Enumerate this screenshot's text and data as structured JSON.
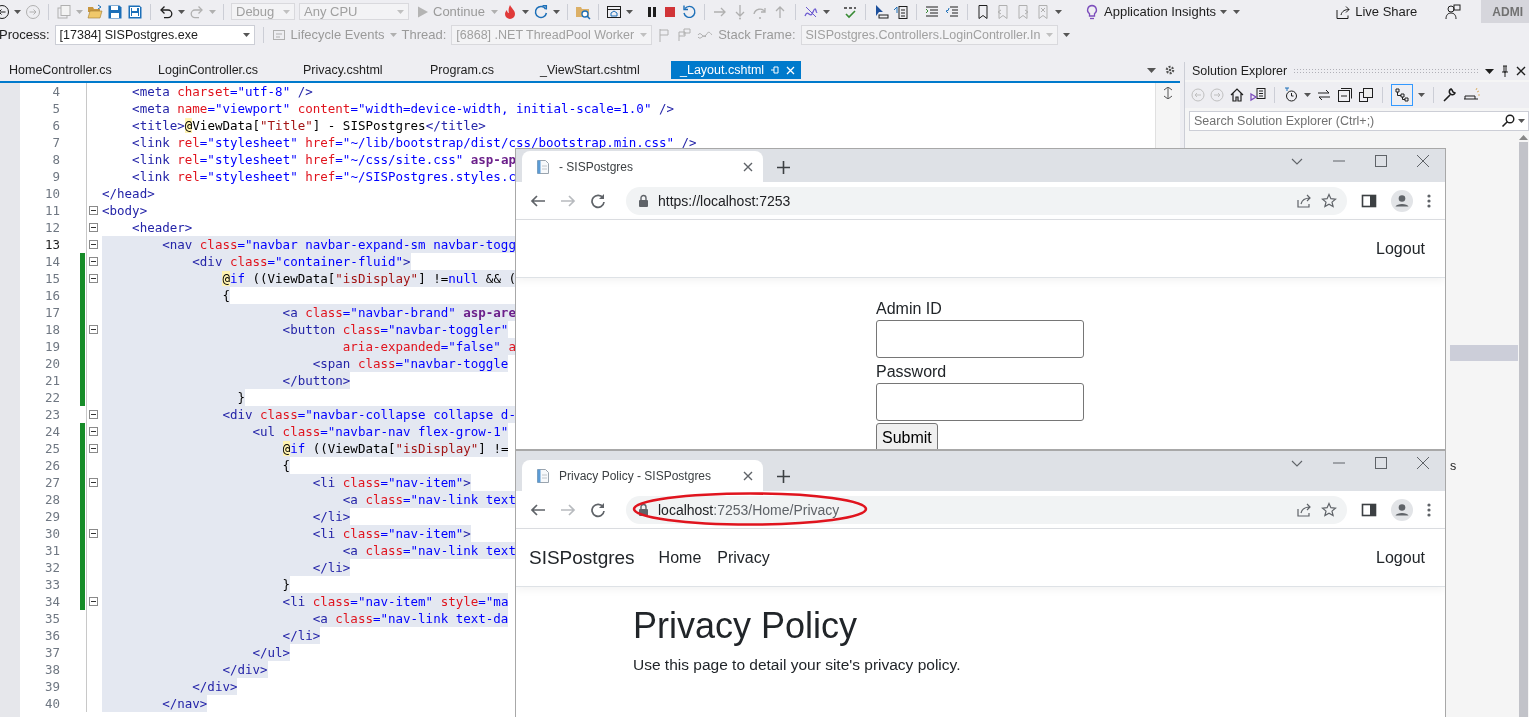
{
  "toolbar": {
    "configuration": "Debug",
    "platform": "Any CPU",
    "continue": "Continue",
    "insights": "Application Insights",
    "live_share": "Live Share",
    "account": "ADMI"
  },
  "debug_location": {
    "process_label": "Process:",
    "process": "[17384] SISPostgres.exe",
    "lifecycle": "Lifecycle Events",
    "thread_label": "Thread:",
    "thread": "[6868] .NET ThreadPool Worker",
    "stack_frame_label": "Stack Frame:",
    "stack_frame": "SISPostgres.Controllers.LoginController.In"
  },
  "tabs": [
    {
      "label": "HomeController.cs",
      "selected": false
    },
    {
      "label": "LoginController.cs",
      "selected": false
    },
    {
      "label": "Privacy.cshtml",
      "selected": false
    },
    {
      "label": "Program.cs",
      "selected": false
    },
    {
      "label": "_ViewStart.cshtml",
      "selected": false
    },
    {
      "label": "_Layout.cshtml",
      "selected": true
    }
  ],
  "editor": {
    "lines": [
      {
        "number": "4",
        "foldable": false,
        "changed": false,
        "selected": false,
        "current": false,
        "tokens": [
          {
            "kind": "tag",
            "text": "    <meta"
          },
          {
            "kind": "attr",
            "text": " charset"
          },
          {
            "kind": "value",
            "text": "=\"utf-8\""
          },
          {
            "kind": "tag",
            "text": " />"
          }
        ]
      },
      {
        "number": "5",
        "foldable": false,
        "changed": false,
        "selected": false,
        "current": false,
        "tokens": [
          {
            "kind": "tag",
            "text": "    <meta"
          },
          {
            "kind": "attr",
            "text": " name"
          },
          {
            "kind": "value",
            "text": "=\"viewport\""
          },
          {
            "kind": "attr",
            "text": " content"
          },
          {
            "kind": "value",
            "text": "=\"width=device-width, initial-scale=1.0\""
          },
          {
            "kind": "tag",
            "text": " />"
          }
        ]
      },
      {
        "number": "6",
        "foldable": false,
        "changed": false,
        "selected": false,
        "current": false,
        "tokens": [
          {
            "kind": "tag",
            "text": "    <title>"
          },
          {
            "kind": "razor",
            "text": "@"
          },
          {
            "kind": "text",
            "text": "ViewData["
          },
          {
            "kind": "string",
            "text": "\"Title\""
          },
          {
            "kind": "text",
            "text": "] - SISPostgres"
          },
          {
            "kind": "tag",
            "text": "</title>"
          }
        ]
      },
      {
        "number": "7",
        "foldable": false,
        "changed": false,
        "selected": false,
        "current": false,
        "tokens": [
          {
            "kind": "tag",
            "text": "    <link"
          },
          {
            "kind": "attr",
            "text": " rel"
          },
          {
            "kind": "value",
            "text": "=\"stylesheet\""
          },
          {
            "kind": "attr",
            "text": " href"
          },
          {
            "kind": "value",
            "text": "=\"~/lib/bootstrap/dist/css/bootstrap.min.css\""
          },
          {
            "kind": "tag",
            "text": " />"
          }
        ]
      },
      {
        "number": "8",
        "foldable": false,
        "changed": false,
        "selected": false,
        "current": false,
        "tokens": [
          {
            "kind": "tag",
            "text": "    <link"
          },
          {
            "kind": "attr",
            "text": " rel"
          },
          {
            "kind": "value",
            "text": "=\"stylesheet\""
          },
          {
            "kind": "attr",
            "text": " href"
          },
          {
            "kind": "value",
            "text": "=\"~/css/site.css\""
          },
          {
            "kind": "helper",
            "text": " asp-ap"
          }
        ]
      },
      {
        "number": "9",
        "foldable": false,
        "changed": false,
        "selected": false,
        "current": false,
        "tokens": [
          {
            "kind": "tag",
            "text": "    <link"
          },
          {
            "kind": "attr",
            "text": " rel"
          },
          {
            "kind": "value",
            "text": "=\"stylesheet\""
          },
          {
            "kind": "attr",
            "text": " href"
          },
          {
            "kind": "value",
            "text": "=\"~/SISPostgres.styles.c"
          }
        ]
      },
      {
        "number": "10",
        "foldable": false,
        "changed": false,
        "selected": false,
        "current": false,
        "tokens": [
          {
            "kind": "tag",
            "text": "</head>"
          }
        ]
      },
      {
        "number": "11",
        "foldable": true,
        "changed": false,
        "selected": false,
        "current": false,
        "tokens": [
          {
            "kind": "tag",
            "text": "<body>"
          }
        ]
      },
      {
        "number": "12",
        "foldable": true,
        "changed": false,
        "selected": false,
        "current": false,
        "tokens": [
          {
            "kind": "tag",
            "text": "    <header>"
          }
        ]
      },
      {
        "number": "13",
        "foldable": true,
        "changed": false,
        "selected": true,
        "current": true,
        "tokens": [
          {
            "kind": "tag",
            "text": "        <nav"
          },
          {
            "kind": "attr",
            "text": " class"
          },
          {
            "kind": "value",
            "text": "=\"navbar navbar-expand-sm navbar-togg"
          }
        ]
      },
      {
        "number": "14",
        "foldable": true,
        "changed": true,
        "selected": true,
        "current": false,
        "tokens": [
          {
            "kind": "tag",
            "text": "            <div"
          },
          {
            "kind": "attr",
            "text": " class"
          },
          {
            "kind": "value",
            "text": "=\"container-fluid\""
          },
          {
            "kind": "tag",
            "text": ">"
          }
        ]
      },
      {
        "number": "15",
        "foldable": true,
        "changed": true,
        "selected": true,
        "current": false,
        "tokens": [
          {
            "kind": "razor",
            "text": "                @"
          },
          {
            "kind": "keyword",
            "text": "if"
          },
          {
            "kind": "text",
            "text": " ((ViewData["
          },
          {
            "kind": "string",
            "text": "\"isDisplay\""
          },
          {
            "kind": "text",
            "text": "] !="
          },
          {
            "kind": "keyword",
            "text": "null"
          },
          {
            "kind": "text",
            "text": " && ("
          }
        ]
      },
      {
        "number": "16",
        "foldable": false,
        "changed": true,
        "selected": true,
        "current": false,
        "tokens": [
          {
            "kind": "text",
            "text": "                {"
          }
        ]
      },
      {
        "number": "17",
        "foldable": false,
        "changed": true,
        "selected": true,
        "current": false,
        "tokens": [
          {
            "kind": "tag",
            "text": "                        <a"
          },
          {
            "kind": "attr",
            "text": " class"
          },
          {
            "kind": "value",
            "text": "=\"navbar-brand\""
          },
          {
            "kind": "helper",
            "text": " asp-are"
          }
        ]
      },
      {
        "number": "18",
        "foldable": true,
        "changed": true,
        "selected": true,
        "current": false,
        "tokens": [
          {
            "kind": "tag",
            "text": "                        <button"
          },
          {
            "kind": "attr",
            "text": " class"
          },
          {
            "kind": "value",
            "text": "=\"navbar-toggler\""
          }
        ]
      },
      {
        "number": "19",
        "foldable": false,
        "changed": true,
        "selected": true,
        "current": false,
        "tokens": [
          {
            "kind": "attr",
            "text": "                                aria-expanded"
          },
          {
            "kind": "value",
            "text": "=\"false\""
          },
          {
            "kind": "attr",
            "text": " a"
          }
        ]
      },
      {
        "number": "20",
        "foldable": false,
        "changed": true,
        "selected": true,
        "current": false,
        "tokens": [
          {
            "kind": "tag",
            "text": "                            <span"
          },
          {
            "kind": "attr",
            "text": " class"
          },
          {
            "kind": "value",
            "text": "=\"navbar-toggle"
          }
        ]
      },
      {
        "number": "21",
        "foldable": false,
        "changed": true,
        "selected": true,
        "current": false,
        "tokens": [
          {
            "kind": "tag",
            "text": "                        </button>"
          }
        ]
      },
      {
        "number": "22",
        "foldable": false,
        "changed": true,
        "selected": true,
        "current": false,
        "tokens": [
          {
            "kind": "text",
            "text": "                  }"
          }
        ]
      },
      {
        "number": "23",
        "foldable": true,
        "changed": false,
        "selected": true,
        "current": false,
        "tokens": [
          {
            "kind": "tag",
            "text": "                <div"
          },
          {
            "kind": "attr",
            "text": " class"
          },
          {
            "kind": "value",
            "text": "=\"navbar-collapse collapse d-"
          }
        ]
      },
      {
        "number": "24",
        "foldable": true,
        "changed": true,
        "selected": true,
        "current": false,
        "tokens": [
          {
            "kind": "tag",
            "text": "                    <ul"
          },
          {
            "kind": "attr",
            "text": " class"
          },
          {
            "kind": "value",
            "text": "=\"navbar-nav flex-grow-1\""
          }
        ]
      },
      {
        "number": "25",
        "foldable": true,
        "changed": true,
        "selected": true,
        "current": false,
        "tokens": [
          {
            "kind": "razor",
            "text": "                        @"
          },
          {
            "kind": "keyword",
            "text": "if"
          },
          {
            "kind": "text",
            "text": " ((ViewData["
          },
          {
            "kind": "string",
            "text": "\"isDisplay\""
          },
          {
            "kind": "text",
            "text": "] !="
          }
        ]
      },
      {
        "number": "26",
        "foldable": false,
        "changed": true,
        "selected": true,
        "current": false,
        "tokens": [
          {
            "kind": "text",
            "text": "                        {"
          }
        ]
      },
      {
        "number": "27",
        "foldable": true,
        "changed": true,
        "selected": true,
        "current": false,
        "tokens": [
          {
            "kind": "tag",
            "text": "                            <li"
          },
          {
            "kind": "attr",
            "text": " class"
          },
          {
            "kind": "value",
            "text": "=\"nav-item\""
          },
          {
            "kind": "tag",
            "text": ">"
          }
        ]
      },
      {
        "number": "28",
        "foldable": false,
        "changed": true,
        "selected": true,
        "current": false,
        "tokens": [
          {
            "kind": "tag",
            "text": "                                <a"
          },
          {
            "kind": "attr",
            "text": " class"
          },
          {
            "kind": "value",
            "text": "=\"nav-link text"
          }
        ]
      },
      {
        "number": "29",
        "foldable": false,
        "changed": true,
        "selected": true,
        "current": false,
        "tokens": [
          {
            "kind": "tag",
            "text": "                            </li>"
          }
        ]
      },
      {
        "number": "30",
        "foldable": true,
        "changed": true,
        "selected": true,
        "current": false,
        "tokens": [
          {
            "kind": "tag",
            "text": "                            <li"
          },
          {
            "kind": "attr",
            "text": " class"
          },
          {
            "kind": "value",
            "text": "=\"nav-item\""
          },
          {
            "kind": "tag",
            "text": ">"
          }
        ]
      },
      {
        "number": "31",
        "foldable": false,
        "changed": true,
        "selected": true,
        "current": false,
        "tokens": [
          {
            "kind": "tag",
            "text": "                                <a"
          },
          {
            "kind": "attr",
            "text": " class"
          },
          {
            "kind": "value",
            "text": "=\"nav-link text"
          }
        ]
      },
      {
        "number": "32",
        "foldable": false,
        "changed": true,
        "selected": true,
        "current": false,
        "tokens": [
          {
            "kind": "tag",
            "text": "                            </li>"
          }
        ]
      },
      {
        "number": "33",
        "foldable": false,
        "changed": true,
        "selected": true,
        "current": false,
        "tokens": [
          {
            "kind": "text",
            "text": "                        }"
          }
        ]
      },
      {
        "number": "34",
        "foldable": true,
        "changed": true,
        "selected": true,
        "current": false,
        "tokens": [
          {
            "kind": "tag",
            "text": "                        <li"
          },
          {
            "kind": "attr",
            "text": " class"
          },
          {
            "kind": "value",
            "text": "=\"nav-item\""
          },
          {
            "kind": "attr",
            "text": " style"
          },
          {
            "kind": "value",
            "text": "=\"ma"
          }
        ]
      },
      {
        "number": "35",
        "foldable": false,
        "changed": false,
        "selected": true,
        "current": false,
        "tokens": [
          {
            "kind": "tag",
            "text": "                            <a"
          },
          {
            "kind": "attr",
            "text": " class"
          },
          {
            "kind": "value",
            "text": "=\"nav-link text-da"
          }
        ]
      },
      {
        "number": "36",
        "foldable": false,
        "changed": false,
        "selected": true,
        "current": false,
        "tokens": [
          {
            "kind": "tag",
            "text": "                        </li>"
          }
        ]
      },
      {
        "number": "37",
        "foldable": false,
        "changed": false,
        "selected": true,
        "current": false,
        "tokens": [
          {
            "kind": "tag",
            "text": "                    </ul>"
          }
        ]
      },
      {
        "number": "38",
        "foldable": false,
        "changed": false,
        "selected": true,
        "current": false,
        "tokens": [
          {
            "kind": "tag",
            "text": "                </div>"
          }
        ]
      },
      {
        "number": "39",
        "foldable": false,
        "changed": false,
        "selected": true,
        "current": false,
        "tokens": [
          {
            "kind": "tag",
            "text": "            </div>"
          }
        ]
      },
      {
        "number": "40",
        "foldable": false,
        "changed": false,
        "selected": true,
        "current": false,
        "tokens": [
          {
            "kind": "tag",
            "text": "        </nav>"
          }
        ]
      }
    ]
  },
  "solution_explorer": {
    "title": "Solution Explorer",
    "search_placeholder": "Search Solution Explorer (Ctrl+;)",
    "items": [
      {
        "selected": true
      },
      {
        "label": "s",
        "selected": false
      }
    ]
  },
  "browsers": [
    {
      "tab_title": "- SISPostgres",
      "url": "https://localhost:7253",
      "annotated": false,
      "page": {
        "kind": "login",
        "logout": "Logout",
        "fields": [
          {
            "label": "Admin ID"
          },
          {
            "label": "Password"
          }
        ],
        "submit": "Submit"
      }
    },
    {
      "tab_title": "Privacy Policy - SISPostgres",
      "url": "localhost",
      "url_dim": ":7253/Home/Privacy",
      "annotated": true,
      "page": {
        "kind": "content",
        "brand": "SISPostgres",
        "links": [
          "Home",
          "Privacy"
        ],
        "logout": "Logout",
        "heading": "Privacy Policy",
        "text": "Use this page to detail your site's privacy policy."
      }
    }
  ]
}
